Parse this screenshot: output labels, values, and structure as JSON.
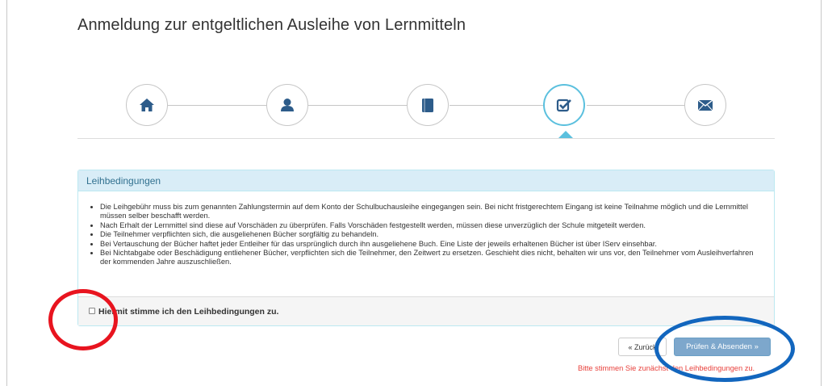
{
  "page": {
    "title": "Anmeldung zur entgeltlichen Ausleihe von Lernmitteln"
  },
  "stepper": {
    "steps": [
      {
        "icon": "home-icon",
        "active": false
      },
      {
        "icon": "user-icon",
        "active": false
      },
      {
        "icon": "book-icon",
        "active": false
      },
      {
        "icon": "check-square-icon",
        "active": true
      },
      {
        "icon": "envelope-icon",
        "active": false
      }
    ],
    "active_color": "#5bc0de"
  },
  "panel": {
    "heading": "Leihbedingungen",
    "items": [
      "Die Leihgebühr muss bis zum genannten Zahlungstermin auf dem Konto der Schulbuchausleihe eingegangen sein. Bei nicht fristgerechtem Eingang ist keine Teilnahme möglich und die Lernmittel müssen selber beschafft werden.",
      "Nach Erhalt der Lernmittel sind diese auf Vorschäden zu überprüfen. Falls Vorschäden festgestellt werden, müssen diese unverzüglich der Schule mitgeteilt werden.",
      "Die Teilnehmer verpflichten sich, die ausgeliehenen Bücher sorgfältig zu behandeln.",
      "Bei Vertauschung der Bücher haftet jeder Entleiher für das ursprünglich durch ihn ausgeliehene Buch. Eine Liste der jeweils erhaltenen Bücher ist über IServ einsehbar.",
      "Bei Nichtabgabe oder Beschädigung entliehener Bücher, verpflichten sich die Teilnehmer, den Zeitwert zu ersetzen. Geschieht dies nicht, behalten wir uns vor, den Teilnehmer vom Ausleihverfahren der kommenden Jahre auszuschließen."
    ],
    "agree_label": "Hiermit stimme ich den Leihbedingungen zu.",
    "agree_checked": false,
    "heading_bg": "#d9edf7"
  },
  "actions": {
    "back_label": "« Zurück",
    "submit_label": "Prüfen & Absenden »",
    "error_text": "Bitte stimmen Sie zunächst den Leihbedingungen zu.",
    "submit_color": "#7da7cc",
    "error_color": "#e8413c"
  },
  "annotations": {
    "red_circle_color": "#e8141f",
    "blue_circle_color": "#1266be"
  }
}
